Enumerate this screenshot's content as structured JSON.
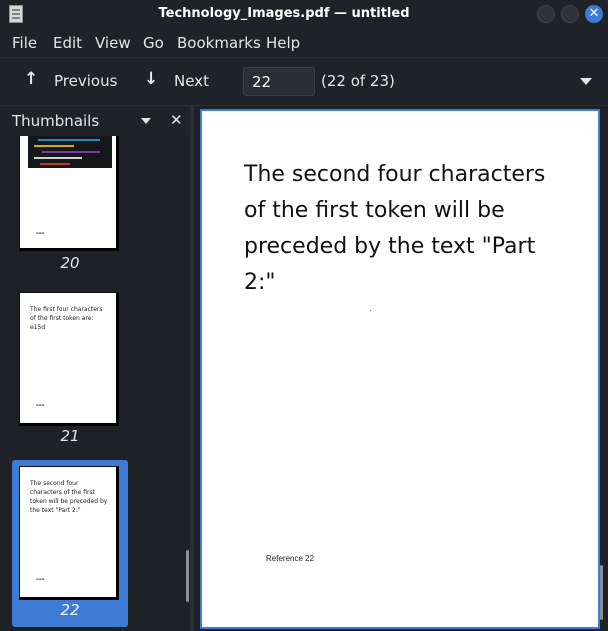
{
  "window": {
    "title": "Technology_Images.pdf — untitled",
    "close_glyph": "✕"
  },
  "menubar": {
    "items": [
      "File",
      "Edit",
      "View",
      "Go",
      "Bookmarks",
      "Help"
    ]
  },
  "toolbar": {
    "previous_label": "Previous",
    "previous_icon": "arrow-up-icon",
    "next_label": "Next",
    "next_icon": "arrow-down-icon",
    "page_value": "22",
    "page_count": "(22 of 23)"
  },
  "sidebar": {
    "title": "Thumbnails",
    "close_glyph": "✕",
    "thumbnails": [
      {
        "number": "20",
        "text": "",
        "selected": false
      },
      {
        "number": "21",
        "text": "The first four characters of the first token are: e15d",
        "selected": false
      },
      {
        "number": "22",
        "text": "The second four characters of the first token will be preceded by the text \"Part 2:\"",
        "selected": true
      }
    ]
  },
  "document": {
    "text": "The second four characters of the first token will be preceded by the text \"Part 2:\"",
    "reference": "Reference 22"
  },
  "colors": {
    "accent": "#3d7bd6",
    "background": "#1e2126",
    "page": "#ffffff"
  }
}
